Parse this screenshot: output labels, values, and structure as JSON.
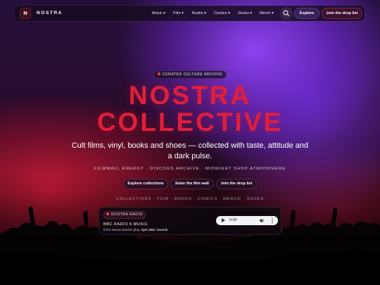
{
  "brand": {
    "logo_letter": "N",
    "name": "NOSTRA"
  },
  "nav": {
    "items": [
      {
        "label": "Music ▾"
      },
      {
        "label": "Film ▾"
      },
      {
        "label": "Books ▾"
      },
      {
        "label": "Comics ▾"
      },
      {
        "label": "Shoes ▾"
      },
      {
        "label": "Merch ▾"
      }
    ],
    "search_icon": "search-icon",
    "explore_label": "Explore",
    "join_label": "Join the drop list"
  },
  "hero": {
    "badge": "CURATED CULTURE ARCHIVE",
    "title_line1": "NOSTRA",
    "title_line2": "COLLECTIVE",
    "subtitle": "Cult films, vinyl, books and shoes — collected with taste, attitude and a dark pulse.",
    "tagline": "FILMWALL ENERGY · DISCOGS ARCHIVE · MIDNIGHT SHOP ATMOSPHERE",
    "buttons": [
      {
        "label": "Explore collections"
      },
      {
        "label": "Enter the film wall"
      },
      {
        "label": "Join the drop list"
      }
    ],
    "categories": "COLLECTIONS · FILM · BOOKS · COMICS · MERCH · SHOES"
  },
  "radio": {
    "tag": "NOSTRA RADIO",
    "station": "BBC RADIO 6 MUSIC",
    "help_prefix": "If the stream doesn't play,",
    "help_link": "open BBC Sounds",
    "player_time": "0:00",
    "icons": [
      "play-icon",
      "volume-icon",
      "more-options-icon"
    ]
  },
  "colors": {
    "accent_red": "#e01f3a",
    "nav_bg": "#160c20",
    "purple_glow": "#9646ff"
  }
}
